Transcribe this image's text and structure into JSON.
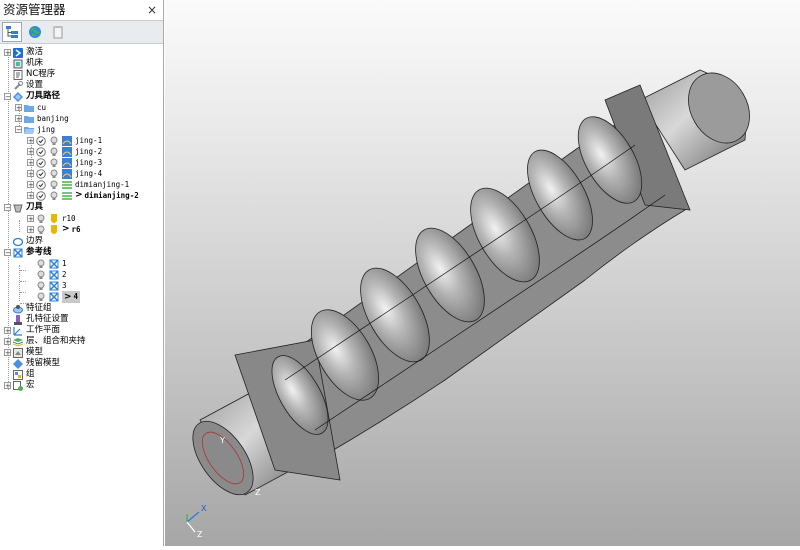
{
  "explorer": {
    "title": "资源管理器",
    "close": "×"
  },
  "toolbar": {
    "icons": [
      "tree-view-icon",
      "globe-icon",
      "clipboard-icon"
    ]
  },
  "tree": {
    "activate": "激活",
    "machine": "机床",
    "nc_program": "NC程序",
    "settings": "设置",
    "toolpaths": "刀具路径",
    "cu": "cu",
    "banjing": "banjing",
    "jing": "jing",
    "jing1": "jing-1",
    "jing2": "jing-2",
    "jing3": "jing-3",
    "jing4": "jing-4",
    "dimianjing1": "dimianjing-1",
    "dimianjing2": "dimianjing-2",
    "tools": "刀具",
    "r10": "r10",
    "r6": "r6",
    "boundary": "边界",
    "patterns": "参考线",
    "p1": "1",
    "p2": "2",
    "p3": "3",
    "p4": "4",
    "feature_sets": "特征组",
    "hole_feature_sets": "孔特征设置",
    "workplanes": "工作平面",
    "layers": "层、组合和夹持",
    "models": "模型",
    "stock_model": "残留模型",
    "groups": "组",
    "macros": "宏"
  },
  "viewport": {
    "axis_x": "X",
    "axis_z": "Z",
    "axis_y": "Y",
    "axis_z2": "Z"
  },
  "colors": {
    "panel_bg": "#ffffff",
    "toolbar_bg": "#e9ecef",
    "accent": "#1e7bd6"
  }
}
